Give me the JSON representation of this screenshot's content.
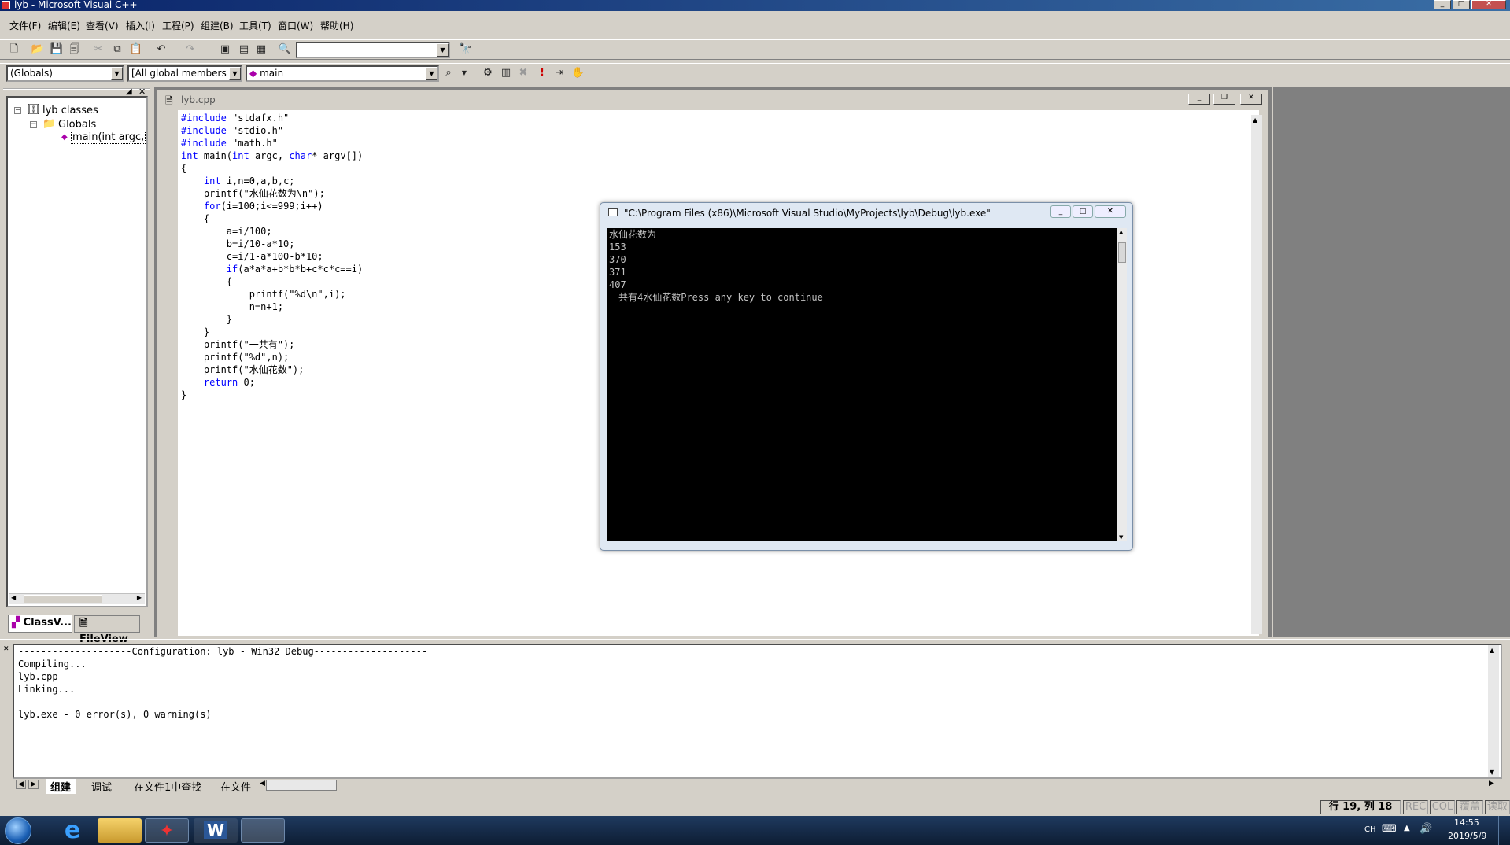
{
  "window": {
    "title": "lyb - Microsoft Visual C++"
  },
  "menu": [
    "文件(F)",
    "编辑(E)",
    "查看(V)",
    "插入(I)",
    "工程(P)",
    "组建(B)",
    "工具(T)",
    "窗口(W)",
    "帮助(H)"
  ],
  "toolbar": {
    "globals_combo": "(Globals)",
    "members_combo": "[All global members",
    "function_combo": "main"
  },
  "classview": {
    "root": "lyb classes",
    "folder": "Globals",
    "item": "main(int argc,",
    "tabs": [
      "ClassV...",
      "FileView"
    ]
  },
  "editor": {
    "tab": "lyb.cpp",
    "lines": [
      "#include \"stdafx.h\"",
      "#include \"stdio.h\"",
      "#include \"math.h\"",
      "int main(int argc, char* argv[])",
      "{",
      "    int i,n=0,a,b,c;",
      "    printf(\"水仙花数为\\n\");",
      "    for(i=100;i<=999;i++)",
      "    {",
      "        a=i/100;",
      "        b=i/10-a*10;",
      "        c=i/1-a*100-b*10;",
      "        if(a*a*a+b*b*b+c*c*c==i)",
      "        {",
      "            printf(\"%d\\n\",i);",
      "            n=n+1;",
      "        }",
      "    }",
      "    printf(\"一共有\");",
      "    printf(\"%d\",n);",
      "    printf(\"水仙花数\");",
      "    return 0;",
      "}"
    ]
  },
  "console": {
    "title": "\"C:\\Program Files (x86)\\Microsoft Visual Studio\\MyProjects\\lyb\\Debug\\lyb.exe\"",
    "lines": [
      "水仙花数为",
      "153",
      "370",
      "371",
      "407",
      "一共有4水仙花数Press any key to continue"
    ]
  },
  "output": {
    "lines": [
      "--------------------Configuration: lyb - Win32 Debug--------------------",
      "Compiling...",
      "lyb.cpp",
      "Linking...",
      "",
      "lyb.exe - 0 error(s), 0 warning(s)"
    ],
    "tabs": [
      "组建",
      "调试",
      "在文件1中查找",
      "在文件"
    ]
  },
  "status": {
    "position": "行 19, 列 18",
    "rec": "REC",
    "col": "COL",
    "ovr": "覆盖",
    "read": "读取"
  },
  "taskbar": {
    "lang": "CH",
    "time": "14:55",
    "date": "2019/5/9"
  }
}
